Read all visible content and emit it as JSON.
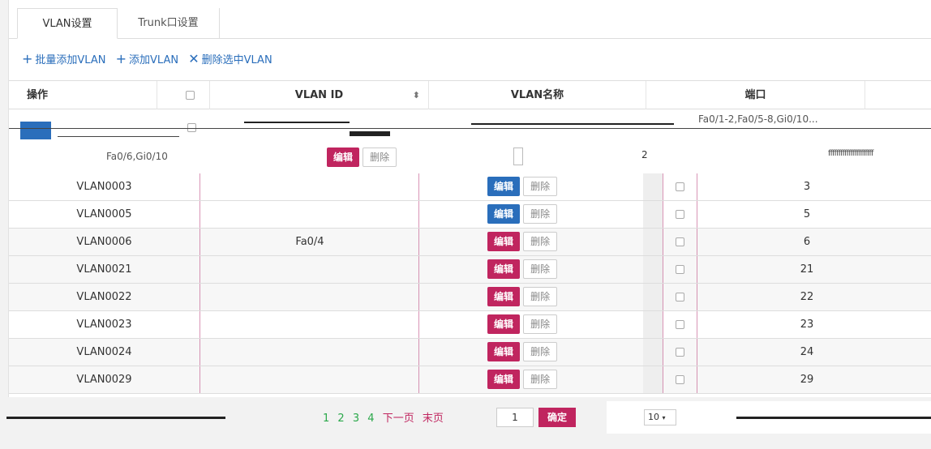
{
  "tabs": [
    {
      "label": "VLAN设置",
      "active": true
    },
    {
      "label": "Trunk口设置",
      "active": false
    }
  ],
  "toolbar": {
    "batch_add": "批量添加VLAN",
    "add": "添加VLAN",
    "delete_selected": "删除选中VLAN"
  },
  "header": {
    "col_op": "操作",
    "col_vlan_id": "VLAN ID",
    "col_vlan_name": "VLAN名称",
    "col_port": "端口"
  },
  "glitch_text": {
    "port_top": "Fa0/1-2,Fa0/5-8,Gi0/10...",
    "port_row2": "Fa0/6,Gi0/10",
    "edit": "编辑",
    "delete": "删除",
    "num_row2": "2",
    "ff_text": "ffffffffffffffffffffff"
  },
  "rows": [
    {
      "name": "VLAN0003",
      "port": "",
      "id": "3",
      "style": "blue",
      "bg": "white"
    },
    {
      "name": "VLAN0005",
      "port": "",
      "id": "5",
      "style": "blue",
      "bg": "white"
    },
    {
      "name": "VLAN0006",
      "port": "Fa0/4",
      "id": "6",
      "style": "red",
      "bg": "grey"
    },
    {
      "name": "VLAN0021",
      "port": "",
      "id": "21",
      "style": "red",
      "bg": "grey"
    },
    {
      "name": "VLAN0022",
      "port": "",
      "id": "22",
      "style": "red",
      "bg": "grey"
    },
    {
      "name": "VLAN0023",
      "port": "",
      "id": "23",
      "style": "red",
      "bg": "white"
    },
    {
      "name": "VLAN0024",
      "port": "",
      "id": "24",
      "style": "red",
      "bg": "grey"
    },
    {
      "name": "VLAN0029",
      "port": "",
      "id": "29",
      "style": "red",
      "bg": "grey"
    }
  ],
  "buttons": {
    "edit": "编辑",
    "delete": "删除"
  },
  "pager": {
    "pages": [
      "1",
      "2",
      "3",
      "4"
    ],
    "next": "下一页",
    "last": "末页",
    "page_input": "1",
    "confirm": "确定",
    "page_size": "10"
  },
  "colors": {
    "edit_blue": "#2a6ebb",
    "edit_red": "#c0255f",
    "link_green": "#2aa84a"
  }
}
